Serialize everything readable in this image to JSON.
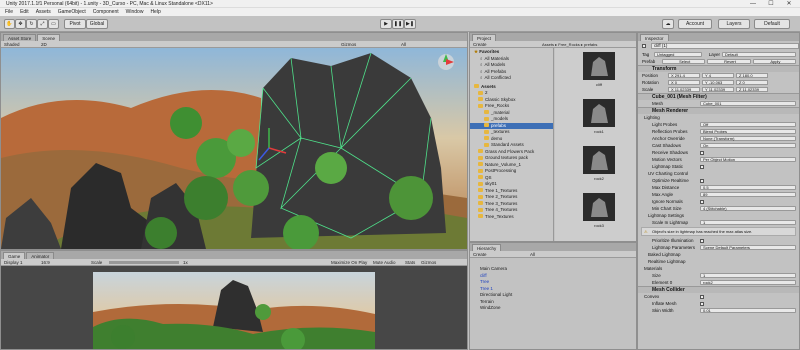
{
  "window": {
    "title": "Unity 2017.1.1f1 Personal (64bit) - 1.unity - 3D_Curso - PC, Mac & Linux Standalone <DX11>",
    "controls": [
      "—",
      "☐",
      "✕"
    ]
  },
  "menu": [
    "File",
    "Edit",
    "Assets",
    "GameObject",
    "Component",
    "Window",
    "Help"
  ],
  "toolbar": {
    "pivot": "Pivot",
    "global": "Global",
    "account": "Account",
    "layers": "Layers",
    "layout": "Default"
  },
  "scene": {
    "tabs": [
      "Asset Store",
      "Scene"
    ],
    "shading": "Shaded",
    "mode2d": "2D",
    "gizmos": "Gizmos",
    "search": "All"
  },
  "game": {
    "tabs": [
      "Game",
      "Animator"
    ],
    "display": "Display 1",
    "aspect": "16:9",
    "scale_label": "Scale",
    "scale_value": "1x",
    "maximize": "Maximize On Play",
    "mute": "Mute Audio",
    "stats": "Stats",
    "gizmos": "Gizmos"
  },
  "project": {
    "tab": "Project",
    "create": "Create",
    "breadcrumb": "Assets ▸ Free_Rocks ▸ prefabs",
    "favorites_title": "Favorites",
    "favorites": [
      "All Materials",
      "All Models",
      "All Prefabs",
      "All Conflicted"
    ],
    "assets_title": "Assets",
    "assets": [
      {
        "label": "2",
        "indent": 1
      },
      {
        "label": "Classic Skybox",
        "indent": 1
      },
      {
        "label": "Free_Rocks",
        "indent": 1
      },
      {
        "label": "_material",
        "indent": 2
      },
      {
        "label": "_models",
        "indent": 2
      },
      {
        "label": "prefabs",
        "indent": 2,
        "selected": true
      },
      {
        "label": "_textures",
        "indent": 2
      },
      {
        "label": "demo",
        "indent": 2
      },
      {
        "label": "Standard Assets",
        "indent": 2
      },
      {
        "label": "Grass And Flowers Pack",
        "indent": 1
      },
      {
        "label": "Ground textures pack",
        "indent": 1
      },
      {
        "label": "Nature_Volume_1",
        "indent": 1
      },
      {
        "label": "PostProcessing",
        "indent": 1
      },
      {
        "label": "QS",
        "indent": 1
      },
      {
        "label": "sky01",
        "indent": 1
      },
      {
        "label": "Tree 1_Textures",
        "indent": 1
      },
      {
        "label": "Tree 2_Textures",
        "indent": 1
      },
      {
        "label": "Tree 3_Textures",
        "indent": 1
      },
      {
        "label": "Tree 4_Textures",
        "indent": 1
      },
      {
        "label": "Tree_Textures",
        "indent": 1
      }
    ],
    "thumbnails": [
      "cliff",
      "rock1",
      "rock2",
      "rock3"
    ]
  },
  "hierarchy": {
    "tab": "Hierarchy",
    "create": "Create",
    "search": "All",
    "items": [
      {
        "label": "Main Camera",
        "color": "#1a1a1a"
      },
      {
        "label": "cliff",
        "color": "#1c3fbf"
      },
      {
        "label": "Tree",
        "color": "#1c3fbf"
      },
      {
        "label": "Tree 1",
        "color": "#1c3fbf"
      },
      {
        "label": "Directional Light",
        "color": "#1a1a1a"
      },
      {
        "label": "Terrain",
        "color": "#1a1a1a"
      },
      {
        "label": "WindZone",
        "color": "#1a1a1a"
      }
    ]
  },
  "inspector": {
    "tab": "Inspector",
    "object_name": "cliff (1)",
    "tag_label": "Tag",
    "tag_value": "Untagged",
    "layer_label": "Layer",
    "layer_value": "Default",
    "prefab_label": "Prefab",
    "prefab_select": "Select",
    "prefab_revert": "Revert",
    "prefab_apply": "Apply",
    "transform_title": "Transform",
    "position_label": "Position",
    "position": [
      "X 291.4",
      "Y 4",
      "Z 180.0"
    ],
    "rotation_label": "Rotation",
    "rotation": [
      "X 0",
      "Y -10.063",
      "Z 0"
    ],
    "scale_label": "Scale",
    "scale": [
      "X 11.02339",
      "Y 11.02339",
      "Z 11.02339"
    ],
    "mesh_filter_title": "Cube_001 (Mesh Filter)",
    "mesh_label": "Mesh",
    "mesh_value": "Cube_001",
    "renderer_title": "Mesh Renderer",
    "lighting_label": "Lighting",
    "renderer_rows": [
      {
        "label": "Light Probes",
        "value": "Off"
      },
      {
        "label": "Reflection Probes",
        "value": "Blend Probes"
      },
      {
        "label": "Anchor Override",
        "value": "None (Transform)"
      },
      {
        "label": "Cast Shadows",
        "value": "On"
      },
      {
        "label": "Receive Shadows",
        "value": ""
      },
      {
        "label": "Motion Vectors",
        "value": "Per Object Motion"
      },
      {
        "label": "Lightmap Static",
        "value": ""
      }
    ],
    "uv_title": "UV Charting Control",
    "uv_rows": [
      {
        "label": "Optimize Realtime",
        "value": ""
      },
      {
        "label": "Max Distance",
        "value": "0.5"
      },
      {
        "label": "Max Angle",
        "value": "89"
      },
      {
        "label": "Ignore Normals",
        "value": ""
      },
      {
        "label": "Min Chart Size",
        "value": "4 (Stitchable)"
      }
    ],
    "lightmap_settings": "Lightmap Settings",
    "scale_lightmap_label": "Scale In Lightmap",
    "scale_lightmap_value": "1",
    "warning": "Object's size in lightmap has reached the max atlas size.",
    "prioritize": "Prioritize Illumination",
    "lightmap_param_label": "Lightmap Parameters",
    "lightmap_param_value": "Scene Default Parameters",
    "baked_lightmap": "Baked Lightmap",
    "realtime_lightmap": "Realtime Lightmap",
    "materials_label": "Materials",
    "size_label": "Size",
    "size_value": "1",
    "element_label": "Element 0",
    "element_value": "rock2",
    "collider_title": "Mesh Collider",
    "convex_label": "Convex",
    "inflate_label": "Inflate Mesh",
    "skin_label": "Skin Width",
    "skin_value": "0.01"
  }
}
